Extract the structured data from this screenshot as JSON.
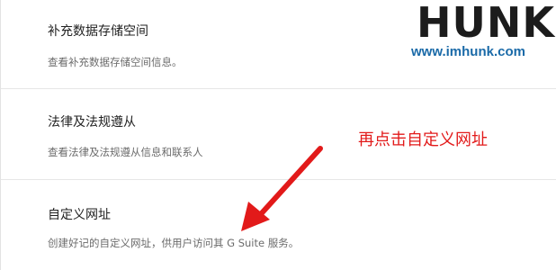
{
  "sections": [
    {
      "title": "补充数据存储空间",
      "description": "查看补充数据存储空间信息。"
    },
    {
      "title": "法律及法规遵从",
      "description": "查看法律及法规遵从信息和联系人"
    },
    {
      "title": "自定义网址",
      "description": "创建好记的自定义网址，供用户访问其 G Suite 服务。"
    }
  ],
  "watermark": {
    "logo_text": "HUNK",
    "url": "www.imhunk.com"
  },
  "annotation": {
    "text": "再点击自定义网址",
    "color": "#e21a1a"
  },
  "colors": {
    "accent_red": "#e21a1a",
    "watermark_blue": "#1a6aa8",
    "title_text": "#222222",
    "desc_text": "#6b6b6b"
  }
}
